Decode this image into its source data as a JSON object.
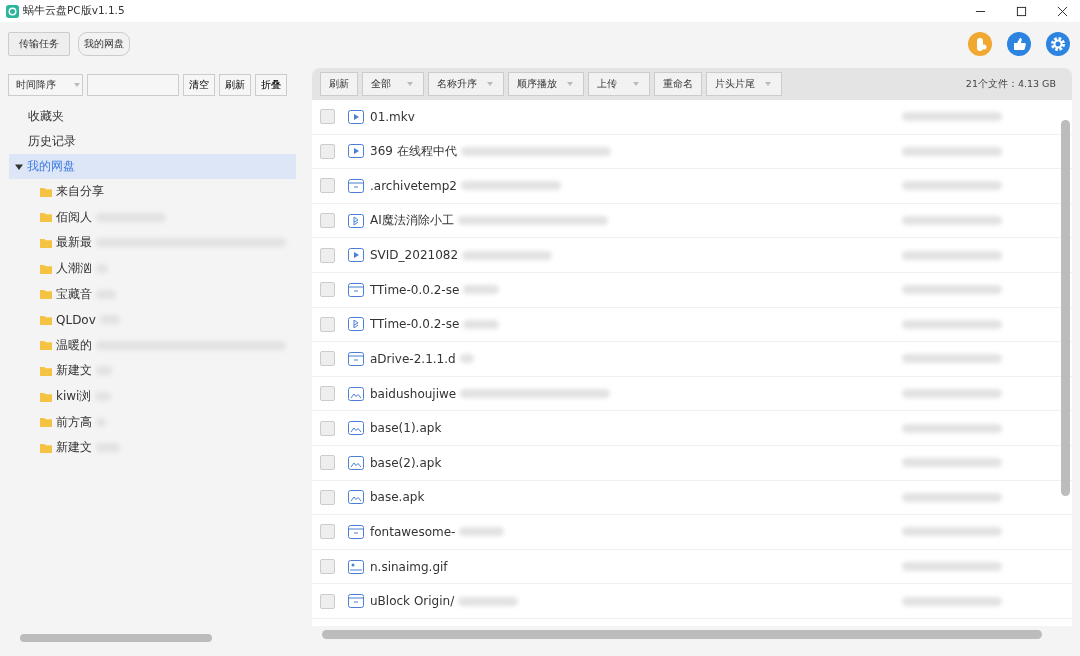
{
  "window": {
    "title": "蜗牛云盘PC版v1.1.5"
  },
  "top_tabs": [
    {
      "label": "传输任务",
      "selected": false
    },
    {
      "label": "我的网盘",
      "selected": true
    }
  ],
  "sidebar": {
    "sort": "时间降序",
    "buttons": [
      "清空",
      "刷新",
      "折叠"
    ],
    "items": [
      {
        "label": "收藏夹",
        "selected": false
      },
      {
        "label": "历史记录",
        "selected": false
      },
      {
        "label": "我的网盘",
        "selected": true,
        "expanded": true,
        "children": [
          {
            "label": "来自分享"
          },
          {
            "label": "佰阅人"
          },
          {
            "label": "最新最"
          },
          {
            "label": "人潮汹"
          },
          {
            "label": "宝藏音"
          },
          {
            "label": "QLDov"
          },
          {
            "label": "温暖的"
          },
          {
            "label": "新建文"
          },
          {
            "label": "kiwi浏"
          },
          {
            "label": "前方高"
          },
          {
            "label": "新建文"
          }
        ]
      }
    ]
  },
  "toolbar": {
    "buttons": [
      {
        "label": "刷新",
        "kind": "button"
      },
      {
        "label": "全部",
        "kind": "dropdown"
      },
      {
        "label": "名称升序",
        "kind": "dropdown"
      },
      {
        "label": "顺序播放",
        "kind": "dropdown"
      },
      {
        "label": "上传",
        "kind": "dropdown"
      },
      {
        "label": "重命名",
        "kind": "button"
      },
      {
        "label": "片头片尾",
        "kind": "dropdown"
      }
    ],
    "summary": "21个文件：4.13 GB"
  },
  "files": [
    {
      "name": "01.mkv",
      "kind": "video",
      "checked": false
    },
    {
      "name": "369 在线程中代",
      "kind": "video",
      "checked": false
    },
    {
      "name": ".archivetemp2",
      "kind": "package",
      "checked": false
    },
    {
      "name": "AI魔法消除小工",
      "kind": "app",
      "checked": false
    },
    {
      "name": "SVID_2021082",
      "kind": "video",
      "checked": false
    },
    {
      "name": "TTime-0.0.2-se",
      "kind": "package",
      "checked": false
    },
    {
      "name": "TTime-0.0.2-se",
      "kind": "app",
      "checked": false
    },
    {
      "name": "aDrive-2.1.1.d",
      "kind": "package",
      "checked": false
    },
    {
      "name": "baidushoujiwe",
      "kind": "apk",
      "checked": false
    },
    {
      "name": "base(1).apk",
      "kind": "apk",
      "checked": false
    },
    {
      "name": "base(2).apk",
      "kind": "apk",
      "checked": false
    },
    {
      "name": "base.apk",
      "kind": "apk",
      "checked": false
    },
    {
      "name": "fontawesome-",
      "kind": "package",
      "checked": false
    },
    {
      "name": "n.sinaimg.gif",
      "kind": "image",
      "checked": false
    },
    {
      "name": "uBlock Origin/",
      "kind": "package",
      "checked": false
    }
  ]
}
